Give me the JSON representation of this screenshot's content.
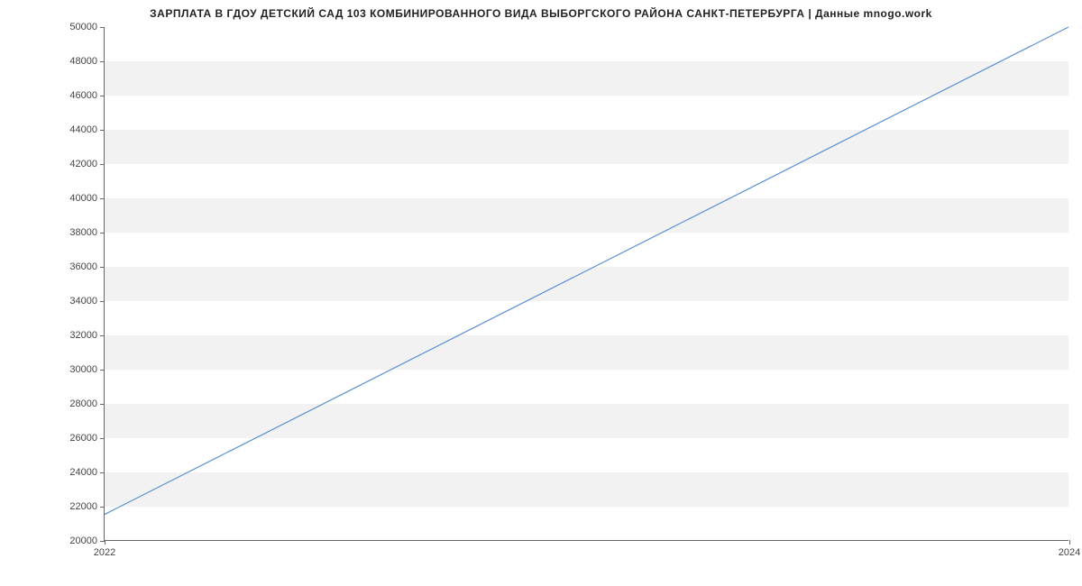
{
  "chart_data": {
    "type": "line",
    "title": "ЗАРПЛАТА В ГДОУ ДЕТСКИЙ САД 103 КОМБИНИРОВАННОГО ВИДА ВЫБОРГСКОГО РАЙОНА САНКТ-ПЕТЕРБУРГА | Данные mnogo.work",
    "x": [
      2022,
      2024
    ],
    "values": [
      21500,
      50000
    ],
    "xlabel": "",
    "ylabel": "",
    "xlim": [
      2022,
      2024
    ],
    "ylim": [
      20000,
      50000
    ],
    "yticks": [
      20000,
      22000,
      24000,
      26000,
      28000,
      30000,
      32000,
      34000,
      36000,
      38000,
      40000,
      42000,
      44000,
      46000,
      48000,
      50000
    ],
    "xticks": [
      2022,
      2024
    ],
    "line_color": "#5b8fd6"
  }
}
